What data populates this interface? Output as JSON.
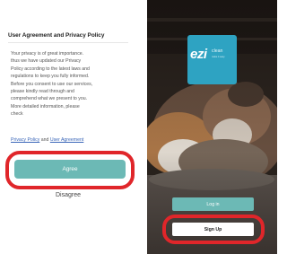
{
  "agreement_screen": {
    "title": "User Agreement and Privacy Policy",
    "body_lines": [
      "Your privacy is of great importance.",
      "thus we have updated our Privacy",
      "Policy according to the latest laws and",
      "regulations to keep you fully informed.",
      "Before you consent to use our services,",
      "please kindly read through and",
      "comprehend what we present to you.",
      "More detailed information, please",
      "check"
    ],
    "privacy_policy_link": "Privacy Policy",
    "and_text": " and ",
    "user_agreement_link": "User Agreement",
    "agree_label": "Agree",
    "disagree_label": "Disagree"
  },
  "welcome_screen": {
    "logo_text": "ezi",
    "logo_subtext": "clean",
    "logo_tagline": "make it easy",
    "login_label": "Log in",
    "signup_label": "Sign Up"
  },
  "colors": {
    "accent_teal": "#6cb9b5",
    "logo_blue": "#2ea3c2",
    "highlight_red": "#e0262a"
  }
}
